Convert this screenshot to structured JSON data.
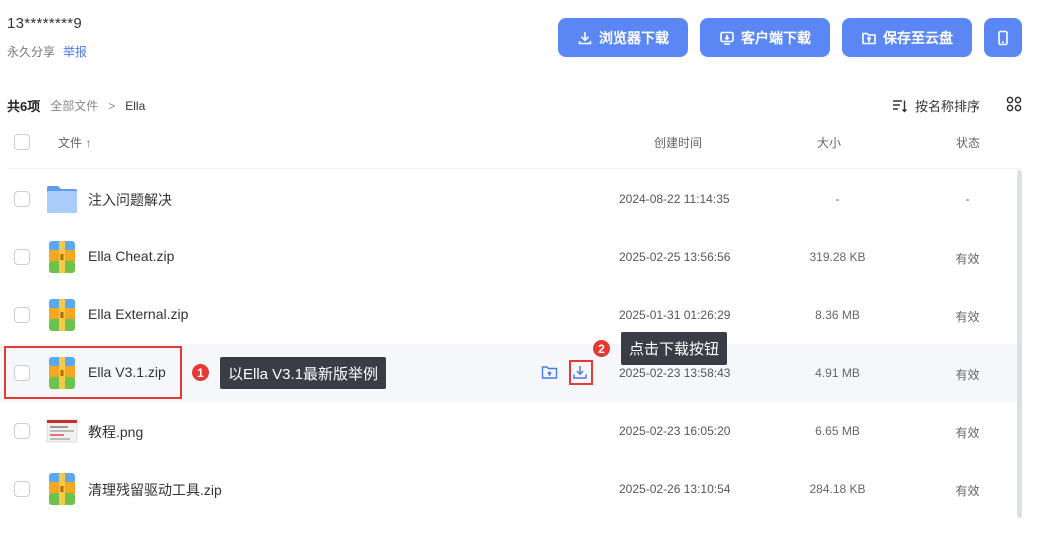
{
  "header": {
    "owner": "13********9",
    "share_type": "永久分享",
    "report": "举报",
    "actions": {
      "browser_download": "浏览器下载",
      "client_download": "客户端下载",
      "save_to_cloud": "保存至云盘"
    }
  },
  "breadcrumb": {
    "count": "共6项",
    "root": "全部文件",
    "separator": ">",
    "current": "Ella"
  },
  "sort": {
    "label": "按名称排序"
  },
  "table": {
    "columns": {
      "file": "文件 ↑",
      "created": "创建时间",
      "size": "大小",
      "status": "状态"
    },
    "rows": [
      {
        "name": "注入问题解决",
        "icon": "folder-icon",
        "created": "2024-08-22 11:14:35",
        "size": "-",
        "status": "-"
      },
      {
        "name": "Ella Cheat.zip",
        "icon": "zip-icon",
        "created": "2025-02-25 13:56:56",
        "size": "319.28 KB",
        "status": "有效"
      },
      {
        "name": "Ella External.zip",
        "icon": "zip-icon",
        "created": "2025-01-31 01:26:29",
        "size": "8.36 MB",
        "status": "有效"
      },
      {
        "name": "Ella V3.1.zip",
        "icon": "zip-icon",
        "created": "2025-02-23 13:58:43",
        "size": "4.91 MB",
        "status": "有效"
      },
      {
        "name": "教程.png",
        "icon": "image-icon",
        "created": "2025-02-23 16:05:20",
        "size": "6.65 MB",
        "status": "有效"
      },
      {
        "name": "清理残留驱动工具.zip",
        "icon": "zip-icon",
        "created": "2025-02-26 13:10:54",
        "size": "284.18 KB",
        "status": "有效"
      }
    ]
  },
  "annotations": {
    "step1_number": "1",
    "step1_text": "以Ella V3.1最新版举例",
    "step2_number": "2",
    "step2_text": "点击下载按钮"
  },
  "colors": {
    "primary": "#5b87f5",
    "annotation_red": "#e53935",
    "tooltip_bg": "#3a3d45"
  }
}
